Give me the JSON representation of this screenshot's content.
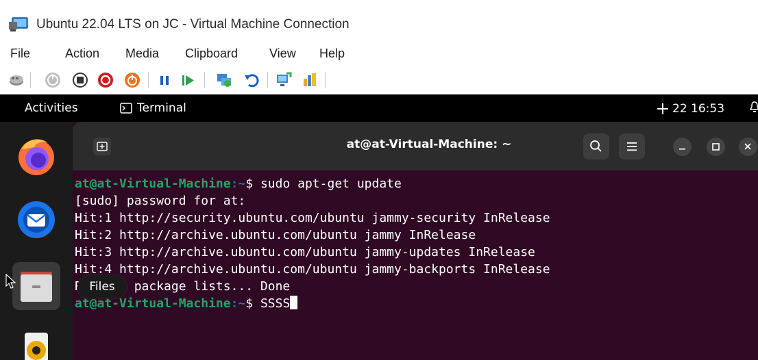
{
  "host": {
    "title": "Ubuntu 22.04 LTS on JC - Virtual Machine Connection",
    "menu": [
      "File",
      "Action",
      "Media",
      "Clipboard",
      "View",
      "Help"
    ],
    "toolbar_icons": [
      "ctrl-alt-del-icon",
      "start-icon",
      "turn-off-icon",
      "shut-down-icon",
      "save-icon",
      "pause-icon",
      "resume-icon",
      "checkpoint-icon",
      "revert-icon",
      "enhanced-session-icon",
      "share-icon"
    ],
    "colors": {
      "shutdown_red": "#d0191c",
      "save_orange": "#e8741f",
      "pause_blue": "#1c5fc0",
      "resume_green": "#2e9e4e"
    }
  },
  "guest": {
    "top_bar": {
      "activities": "Activities",
      "app_name": "Terminal",
      "clock": "22 16:53"
    },
    "dock": {
      "items": [
        "firefox-icon",
        "thunderbird-icon",
        "files-icon",
        "rhythmbox-icon"
      ],
      "tooltip": "Files"
    },
    "terminal": {
      "title": "at@at-Virtual-Machine: ~",
      "prompt_user": "at@at-Virtual-Machine",
      "prompt_path": ":~",
      "prompt_symbol": "$ ",
      "lines": [
        "[sudo] password for at:",
        "Hit:1 http://security.ubuntu.com/ubuntu jammy-security InRelease",
        "Hit:2 http://archive.ubuntu.com/ubuntu jammy InRelease",
        "Hit:3 http://archive.ubuntu.com/ubuntu jammy-updates InRelease",
        "Hit:4 http://archive.ubuntu.com/ubuntu jammy-backports InRelease",
        "Reading package lists... Done"
      ],
      "command_1": "sudo apt-get update",
      "command_2": "SSSS",
      "colors": {
        "background": "#300a24",
        "prompt_user": "#26a269",
        "prompt_path": "#3465a4"
      }
    }
  }
}
